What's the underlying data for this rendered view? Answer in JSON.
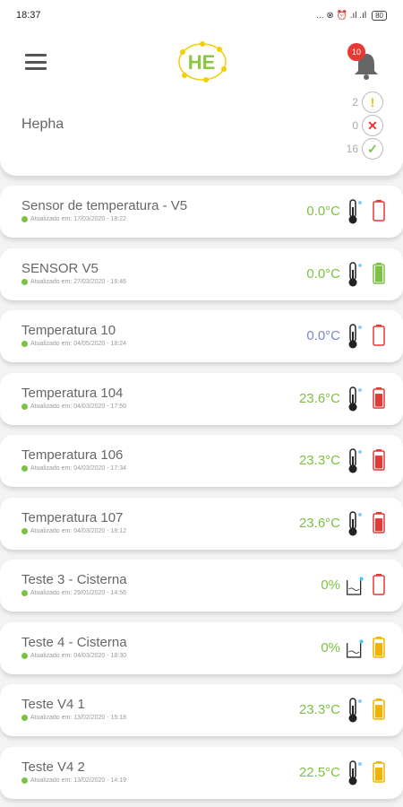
{
  "status_bar": {
    "time": "18:37",
    "icons_text": "... ⊗ ⏰ .ıl .ıl",
    "battery": "80"
  },
  "header": {
    "logo_text": "HE",
    "notification_count": "10",
    "company": "Hepha",
    "counters": [
      {
        "value": "2",
        "icon": "warning-icon",
        "color": "#e6c200",
        "symbol": "!"
      },
      {
        "value": "0",
        "icon": "error-icon",
        "color": "#e53935",
        "symbol": "✕"
      },
      {
        "value": "16",
        "icon": "check-icon",
        "color": "#7cc242",
        "symbol": "✓"
      }
    ]
  },
  "colors": {
    "green": "#7cc242",
    "blue": "#7986cb",
    "red": "#e53935",
    "yellow": "#f0b400",
    "accent": "#7cc242"
  },
  "devices": [
    {
      "name": "Sensor de temperatura - V5",
      "updated": "Atualizado em: 17/03/2020 - 18:22",
      "value": "0.0°C",
      "value_color": "#7cc242",
      "sensor": "thermometer",
      "battery": "empty",
      "battery_color": "#e53935",
      "battery_level": 0
    },
    {
      "name": "SENSOR V5",
      "updated": "Atualizado em: 27/03/2020 - 16:46",
      "value": "0.0°C",
      "value_color": "#7cc242",
      "sensor": "thermometer",
      "battery": "full",
      "battery_color": "#7cc242",
      "battery_level": 1
    },
    {
      "name": "Temperatura 10",
      "updated": "Atualizado em: 04/05/2020 - 18:24",
      "value": "0.0°C",
      "value_color": "#7986cb",
      "sensor": "thermometer",
      "battery": "empty",
      "battery_color": "#e53935",
      "battery_level": 0
    },
    {
      "name": "Temperatura 104",
      "updated": "Atualizado em: 04/03/2020 - 17:50",
      "value": "23.6°C",
      "value_color": "#7cc242",
      "sensor": "thermometer",
      "battery": "low",
      "battery_color": "#e53935",
      "battery_level": 0.8
    },
    {
      "name": "Temperatura 106",
      "updated": "Atualizado em: 04/03/2020 - 17:34",
      "value": "23.3°C",
      "value_color": "#7cc242",
      "sensor": "thermometer",
      "battery": "low",
      "battery_color": "#e53935",
      "battery_level": 0.8
    },
    {
      "name": "Temperatura 107",
      "updated": "Atualizado em: 04/03/2020 - 18:12",
      "value": "23.6°C",
      "value_color": "#7cc242",
      "sensor": "thermometer",
      "battery": "low",
      "battery_color": "#e53935",
      "battery_level": 0.8
    },
    {
      "name": "Teste 3 - Cisterna",
      "updated": "Atualizado em: 29/01/2020 - 14:56",
      "value": "0%",
      "value_color": "#7cc242",
      "sensor": "tank",
      "battery": "empty",
      "battery_color": "#e53935",
      "battery_level": 0
    },
    {
      "name": "Teste 4 - Cisterna",
      "updated": "Atualizado em: 04/03/2020 - 18:30",
      "value": "0%",
      "value_color": "#7cc242",
      "sensor": "tank",
      "battery": "medium",
      "battery_color": "#f0b400",
      "battery_level": 0.8
    },
    {
      "name": "Teste V4 1",
      "updated": "Atualizado em: 13/02/2020 - 15:18",
      "value": "23.3°C",
      "value_color": "#7cc242",
      "sensor": "thermometer",
      "battery": "medium",
      "battery_color": "#f0b400",
      "battery_level": 0.8
    },
    {
      "name": "Teste V4 2",
      "updated": "Atualizado em: 13/02/2020 - 14:19",
      "value": "22.5°C",
      "value_color": "#7cc242",
      "sensor": "thermometer",
      "battery": "medium",
      "battery_color": "#f0b400",
      "battery_level": 0.8
    }
  ]
}
